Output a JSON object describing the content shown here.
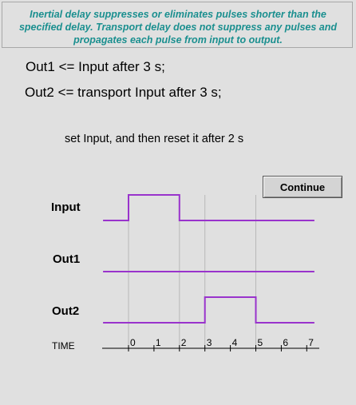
{
  "banner": {
    "lines": [
      "Inertial delay suppresses or eliminates pulses shorter than the",
      "specified delay. Transport delay does not suppress any pulses and",
      "propagates each pulse from input to output."
    ]
  },
  "code": {
    "line1": "Out1 <= Input after 3 s;",
    "line2": "Out2 <= transport Input after 3 s;"
  },
  "instruction": "set Input, and then reset it after 2 s",
  "continue_label": "Continue",
  "signals": {
    "input_label": "Input",
    "out1_label": "Out1",
    "out2_label": "Out2",
    "time_label": "TIME"
  },
  "colors": {
    "waveform": "#9933cc",
    "banner_text": "#1a8f8f",
    "gridline": "#b8b8b8"
  },
  "time_ticks": [
    "0",
    "1",
    "2",
    "3",
    "4",
    "5",
    "6",
    "7"
  ],
  "waveforms": {
    "input": [
      [
        -1,
        0
      ],
      [
        0,
        1
      ],
      [
        2,
        0
      ],
      [
        7.3,
        0
      ]
    ],
    "out1": [
      [
        -1,
        0
      ],
      [
        7.3,
        0
      ]
    ],
    "out2": [
      [
        -1,
        0
      ],
      [
        3,
        1
      ],
      [
        5,
        0
      ],
      [
        7.3,
        0
      ]
    ]
  },
  "markers": [
    0,
    2,
    3,
    5
  ]
}
